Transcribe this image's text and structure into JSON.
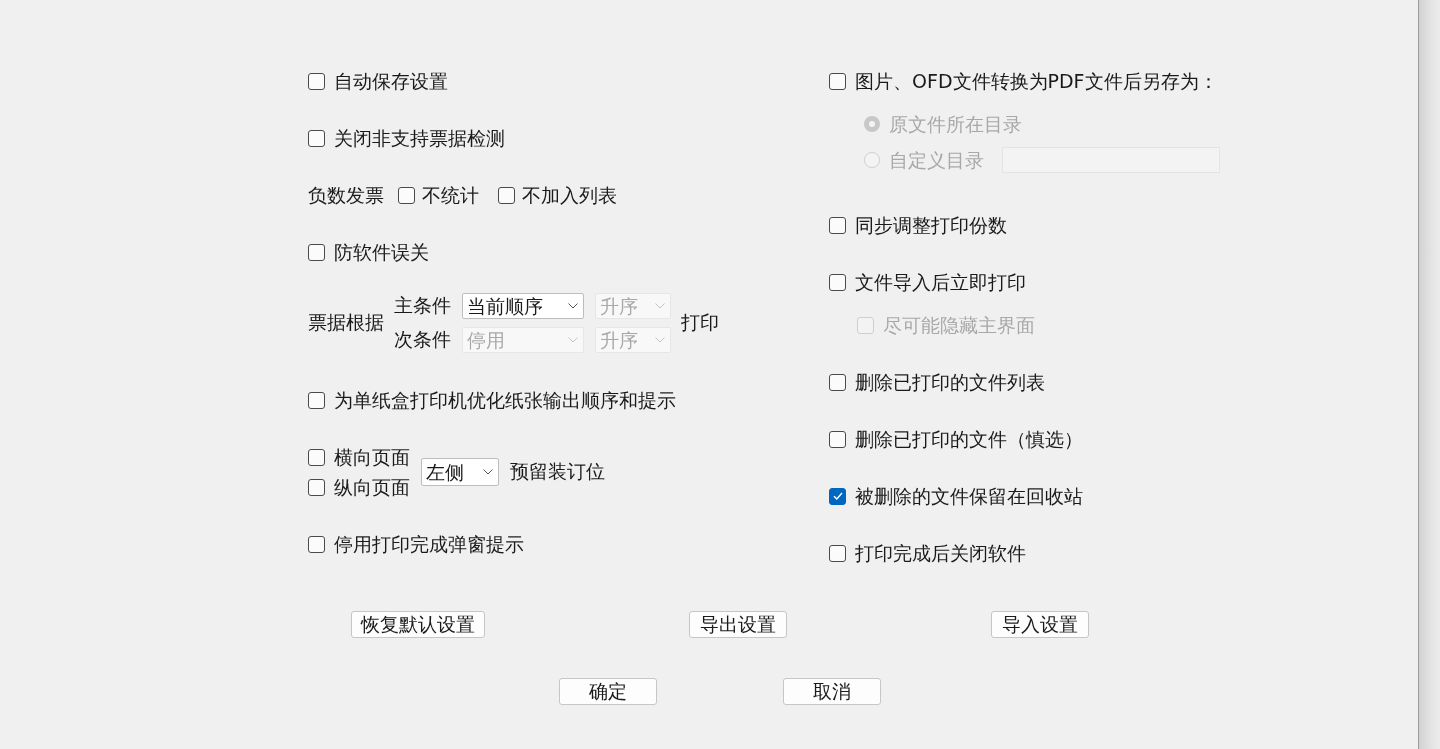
{
  "left_column": [
    {
      "kind": "checkbox",
      "label": "自动保存设置",
      "checked": false
    },
    {
      "kind": "checkbox",
      "label": "关闭非支持票据检测",
      "checked": false
    },
    {
      "kind": "checkbox_group",
      "label": "负数发票",
      "options": [
        {
          "label": "不统计",
          "checked": false
        },
        {
          "label": "不加入列表",
          "checked": false
        }
      ]
    },
    {
      "kind": "checkbox",
      "label": "防软件误关",
      "checked": false
    },
    {
      "kind": "sort_order",
      "label": "票据根据",
      "conditions": [
        {
          "label": "主条件",
          "key": {
            "value": "当前顺序",
            "disabled": false
          },
          "order": {
            "value": "升序",
            "disabled": true
          }
        },
        {
          "label": "次条件",
          "key": {
            "value": "停用",
            "disabled": true
          },
          "order": {
            "value": "升序",
            "disabled": true
          }
        }
      ],
      "suffix": "打印"
    },
    {
      "kind": "checkbox",
      "label": "为单纸盒打印机优化纸张输出顺序和提示",
      "checked": false
    },
    {
      "kind": "binding_margin",
      "pages": [
        {
          "label": "横向页面",
          "checked": false
        },
        {
          "label": "纵向页面",
          "checked": false
        }
      ],
      "side": {
        "value": "左侧",
        "disabled": false
      },
      "suffix": "预留装订位"
    },
    {
      "kind": "checkbox",
      "label": "停用打印完成弹窗提示",
      "checked": false
    }
  ],
  "right_column": [
    {
      "kind": "checkbox",
      "label": "图片、OFD文件转换为PDF文件后另存为：",
      "checked": false,
      "options": [
        {
          "label": "原文件所在目录",
          "selected": true,
          "disabled": true
        },
        {
          "label": "自定义目录",
          "selected": false,
          "disabled": true,
          "path_field": {
            "disabled": true
          }
        }
      ]
    },
    {
      "kind": "checkbox",
      "label": "同步调整打印份数",
      "checked": false
    },
    {
      "kind": "checkbox",
      "label": "文件导入后立即打印",
      "checked": false,
      "children": [
        {
          "label": "尽可能隐藏主界面",
          "checked": false,
          "disabled": true
        }
      ]
    },
    {
      "kind": "checkbox",
      "label": "删除已打印的文件列表",
      "checked": false
    },
    {
      "kind": "checkbox",
      "label": "删除已打印的文件（慎选）",
      "checked": false
    },
    {
      "kind": "checkbox",
      "label": "被删除的文件保留在回收站",
      "checked": true
    },
    {
      "kind": "checkbox",
      "label": "打印完成后关闭软件",
      "checked": false
    }
  ],
  "action_buttons": [
    "恢复默认设置",
    "导出设置",
    "导入设置"
  ],
  "dialog_buttons": [
    "确定",
    "取消"
  ]
}
